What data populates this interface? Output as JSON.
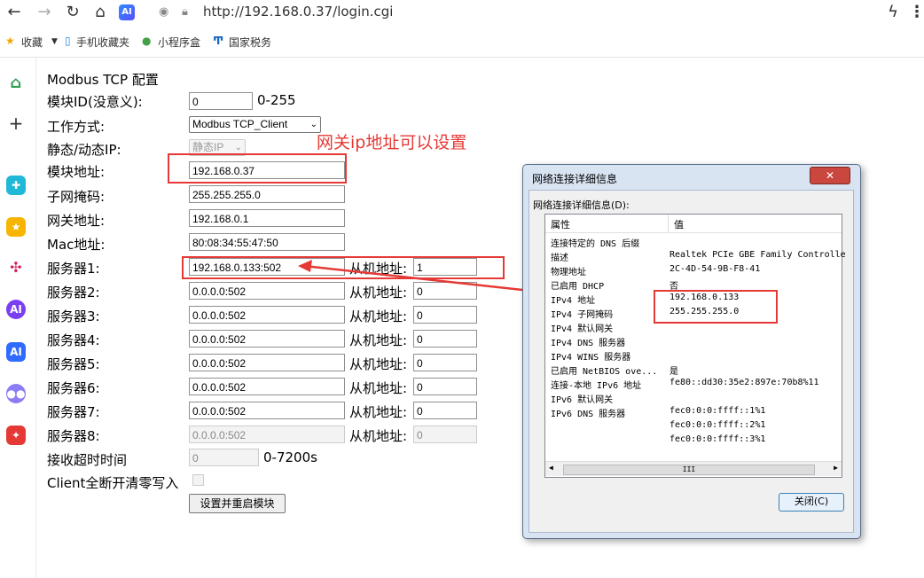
{
  "browser": {
    "url": "http://192.168.0.37/login.cgi",
    "ai_badge": "AI",
    "bookmarks": [
      "收藏",
      "手机收藏夹",
      "小程序盒",
      "国家税务"
    ]
  },
  "form": {
    "heading": "Modbus TCP 配置",
    "module_id": {
      "label": "模块ID(没意义):",
      "value": "0",
      "hint": "0-255"
    },
    "work_mode": {
      "label": "工作方式:",
      "value": "Modbus TCP_Client"
    },
    "ip_mode": {
      "label": "静态/动态IP:",
      "value": "静态IP"
    },
    "module_addr": {
      "label": "模块地址:",
      "value": "192.168.0.37"
    },
    "subnet": {
      "label": "子网掩码:",
      "value": "255.255.255.0"
    },
    "gateway": {
      "label": "网关地址:",
      "value": "192.168.0.1"
    },
    "mac": {
      "label": "Mac地址:",
      "value": "80:08:34:55:47:50"
    },
    "slave_label": "从机地址:",
    "servers": [
      {
        "label": "服务器1:",
        "value": "192.168.0.133:502",
        "slave": "1"
      },
      {
        "label": "服务器2:",
        "value": "0.0.0.0:502",
        "slave": "0"
      },
      {
        "label": "服务器3:",
        "value": "0.0.0.0:502",
        "slave": "0"
      },
      {
        "label": "服务器4:",
        "value": "0.0.0.0:502",
        "slave": "0"
      },
      {
        "label": "服务器5:",
        "value": "0.0.0.0:502",
        "slave": "0"
      },
      {
        "label": "服务器6:",
        "value": "0.0.0.0:502",
        "slave": "0"
      },
      {
        "label": "服务器7:",
        "value": "0.0.0.0:502",
        "slave": "0"
      },
      {
        "label": "服务器8:",
        "value": "0.0.0.0:502",
        "slave": "0"
      }
    ],
    "timeout": {
      "label": "接收超时时间",
      "value": "0",
      "hint": "0-7200s"
    },
    "client_clear": {
      "label": "Client全断开清零写入"
    },
    "submit": "设置并重启模块"
  },
  "annotation": "网关ip地址可以设置",
  "dialog": {
    "title": "网络连接详细信息",
    "caption": "网络连接详细信息(D):",
    "col_property": "属性",
    "col_value": "值",
    "rows": [
      {
        "k": "连接特定的 DNS 后缀",
        "v": ""
      },
      {
        "k": "描述",
        "v": "Realtek PCIe GBE Family Controlle"
      },
      {
        "k": "物理地址",
        "v": "2C-4D-54-9B-F8-41"
      },
      {
        "k": "已启用 DHCP",
        "v": "否"
      },
      {
        "k": "IPv4 地址",
        "v": "192.168.0.133"
      },
      {
        "k": "IPv4 子网掩码",
        "v": "255.255.255.0"
      },
      {
        "k": "IPv4 默认网关",
        "v": ""
      },
      {
        "k": "IPv4 DNS 服务器",
        "v": ""
      },
      {
        "k": "IPv4 WINS 服务器",
        "v": ""
      },
      {
        "k": "已启用 NetBIOS ove...",
        "v": "是"
      },
      {
        "k": "连接-本地 IPv6 地址",
        "v": "fe80::dd30:35e2:897e:70b8%11"
      },
      {
        "k": "IPv6 默认网关",
        "v": ""
      },
      {
        "k": "IPv6 DNS 服务器",
        "v": "fec0:0:0:ffff::1%1"
      },
      {
        "k": "",
        "v": "fec0:0:0:ffff::2%1"
      },
      {
        "k": "",
        "v": "fec0:0:0:ffff::3%1"
      }
    ],
    "close_label": "关闭(C)",
    "close_glyph": "✕",
    "scroll_thumb": "III"
  },
  "colors": {
    "accent_red": "#e53935"
  }
}
